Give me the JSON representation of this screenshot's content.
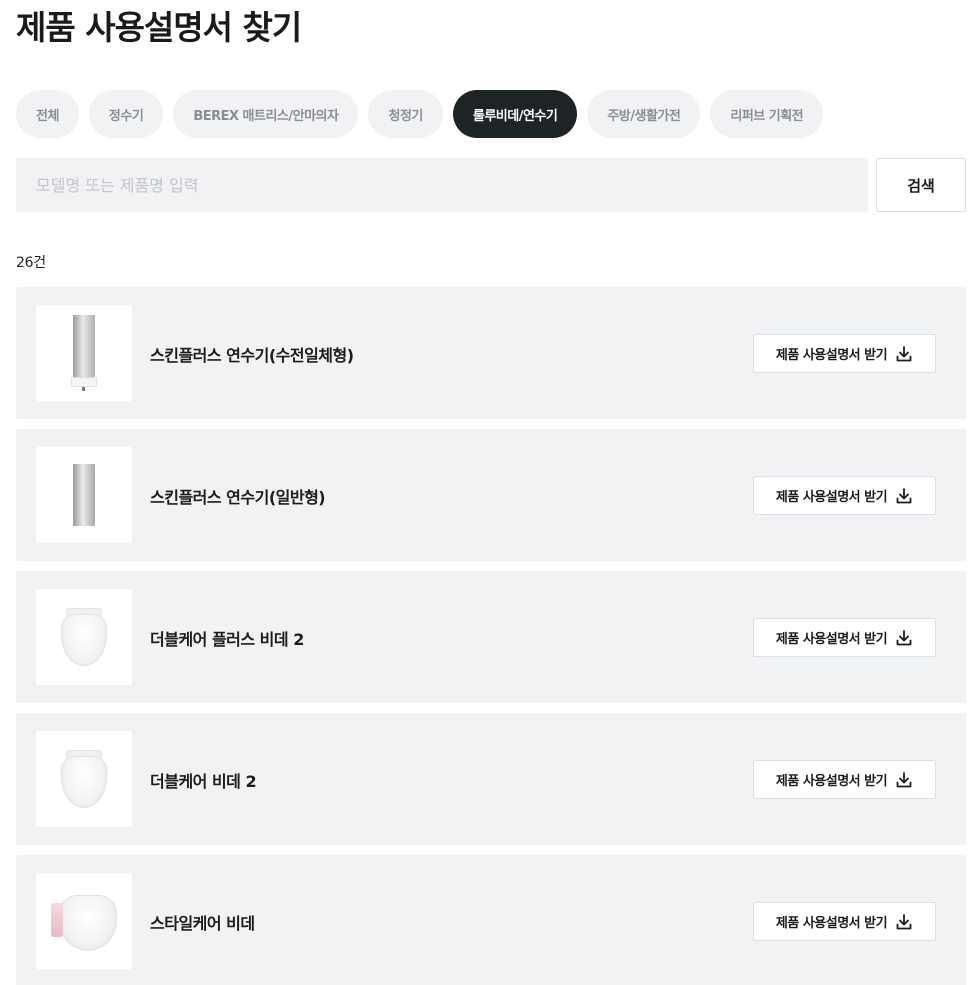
{
  "page": {
    "title": "제품 사용설명서 찾기"
  },
  "tabs": [
    {
      "label": "전체",
      "active": false
    },
    {
      "label": "정수기",
      "active": false
    },
    {
      "label": "BEREX 매트리스/안마의자",
      "active": false
    },
    {
      "label": "청정기",
      "active": false
    },
    {
      "label": "룰루비데/연수기",
      "active": true
    },
    {
      "label": "주방/생활가전",
      "active": false
    },
    {
      "label": "리퍼브 기획전",
      "active": false
    }
  ],
  "search": {
    "placeholder": "모델명 또는 제품명 입력",
    "value": "",
    "button_label": "검색"
  },
  "results": {
    "count_label": "26건",
    "download_label": "제품 사용설명서 받기",
    "items": [
      {
        "name": "스킨플러스 연수기(수전일체형)",
        "image": "softener-integrated"
      },
      {
        "name": "스킨플러스 연수기(일반형)",
        "image": "softener-standard"
      },
      {
        "name": "더블케어 플러스 비데 2",
        "image": "bidet-white"
      },
      {
        "name": "더블케어 비데 2",
        "image": "bidet-white"
      },
      {
        "name": "스타일케어 비데",
        "image": "bidet-side-panel"
      }
    ]
  },
  "icons": {
    "download": "download-icon"
  },
  "colors": {
    "active_tab_bg": "#1e2326",
    "tab_bg": "#f1f2f4",
    "card_bg": "#f1f2f4"
  }
}
